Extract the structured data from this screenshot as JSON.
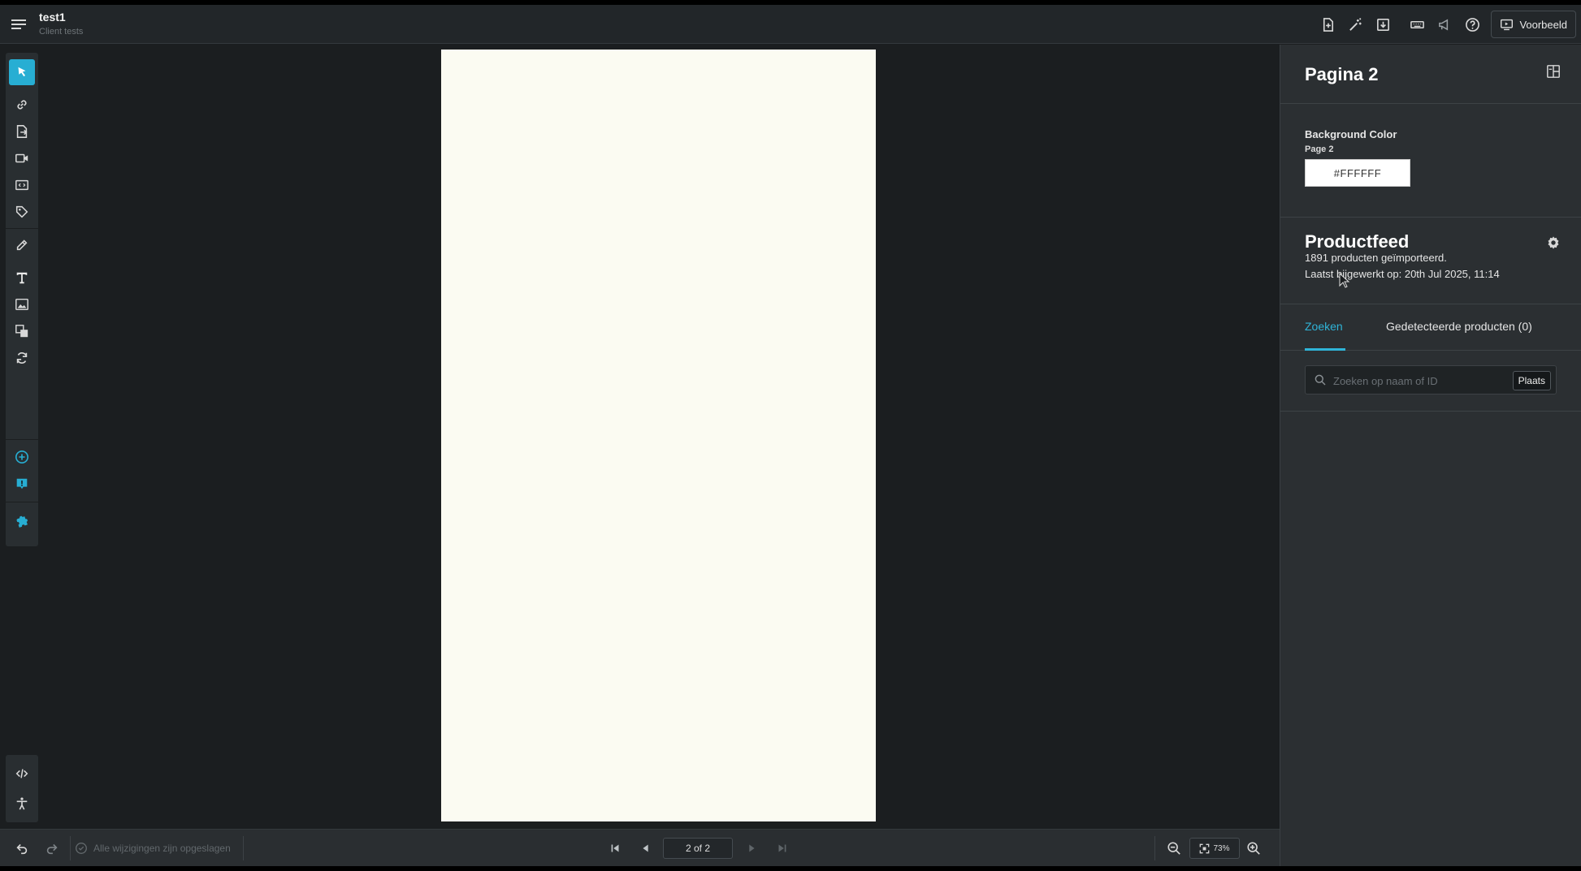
{
  "header": {
    "doc_title": "test1",
    "doc_subtitle": "Client tests",
    "preview_label": "Voorbeeld"
  },
  "properties": {
    "page_title": "Pagina 2",
    "background_label": "Background Color",
    "page_label": "Page 2",
    "background_value": "#FFFFFF"
  },
  "productfeed": {
    "title": "Productfeed",
    "imported_text": "1891 producten geïmporteerd.",
    "updated_text": "Laatst bijgewerkt op: 20th Jul 2025, 11:14"
  },
  "tabs": {
    "search_label": "Zoeken",
    "detected_label": "Gedetecteerde producten (0)"
  },
  "search": {
    "placeholder": "Zoeken op naam of ID",
    "value": "",
    "place_label": "Plaats"
  },
  "status": {
    "saved_text": "Alle wijzigingen zijn opgeslagen"
  },
  "pagination": {
    "indicator": "2 of 2"
  },
  "zoom": {
    "level": "73%"
  },
  "colors": {
    "accent": "#27aed3",
    "panel": "#2b2f32",
    "canvas_bg": "#1b1e20",
    "page_fill": "#fbfbf2"
  }
}
